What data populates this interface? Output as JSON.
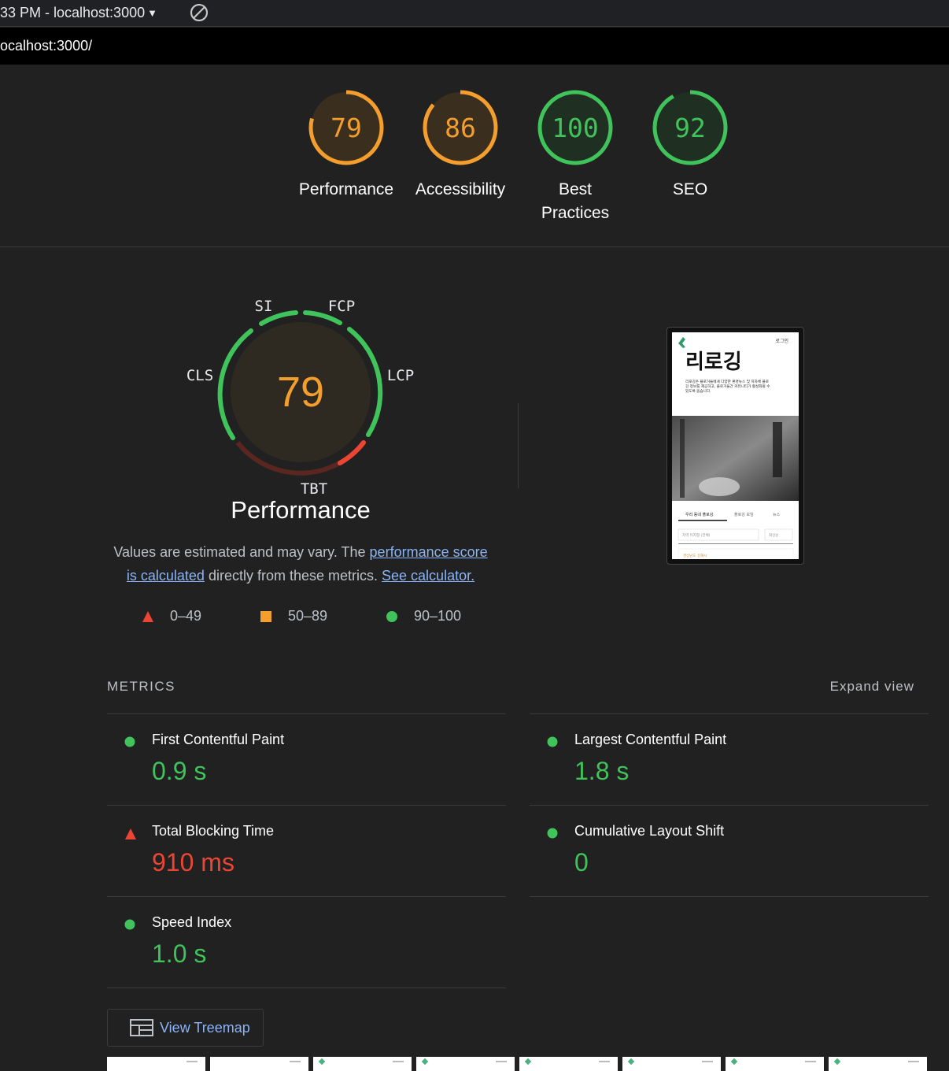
{
  "toolbar": {
    "report_select_label": "33 PM - localhost:3000",
    "clear_icon": "block-icon"
  },
  "url": "localhost:3000/",
  "categories": [
    {
      "name": "Performance",
      "score": 79,
      "color": "#f39e2d",
      "bg": "#3a2e1f"
    },
    {
      "name": "Accessibility",
      "score": 86,
      "color": "#f39e2d",
      "bg": "#3a2e1f"
    },
    {
      "name": "Best Practices",
      "score": 100,
      "color": "#3fc35a",
      "bg": "#1f2f22"
    },
    {
      "name": "SEO",
      "score": 92,
      "color": "#3fc35a",
      "bg": "#1f2f22"
    }
  ],
  "performance": {
    "score": 79,
    "title": "Performance",
    "metric_labels": {
      "si": "SI",
      "fcp": "FCP",
      "lcp": "LCP",
      "tbt": "TBT",
      "cls": "CLS"
    },
    "description_pre": "Values are estimated and may vary. The ",
    "link_score": "performance score is calculated",
    "description_mid": " directly from these metrics. ",
    "link_calculator": "See calculator."
  },
  "legend": [
    {
      "icon": "red-triangle-icon",
      "range": "0–49"
    },
    {
      "icon": "orange-square-icon",
      "range": "50–89"
    },
    {
      "icon": "green-circle-icon",
      "range": "90–100"
    }
  ],
  "metrics_section": {
    "title": "METRICS",
    "expand_label": "Expand view"
  },
  "metrics": [
    {
      "name": "First Contentful Paint",
      "value": "0.9 s",
      "status": "pass"
    },
    {
      "name": "Largest Contentful Paint",
      "value": "1.8 s",
      "status": "pass"
    },
    {
      "name": "Total Blocking Time",
      "value": "910 ms",
      "status": "fail"
    },
    {
      "name": "Cumulative Layout Shift",
      "value": "0",
      "status": "pass"
    },
    {
      "name": "Speed Index",
      "value": "1.0 s",
      "status": "pass"
    }
  ],
  "treemap_label": "View Treemap",
  "screenshot": {
    "login": "로그인",
    "brand": "리로깅",
    "desc_line1": "리로깅은 플로거들에게 다양한 환경뉴스 및 지자체 플로",
    "desc_line2": "깅 정보를 제공하고, 플로거들간 커뮤니티가 활성화될 수",
    "desc_line3": "있도록 돕습니다.",
    "tab1": "우리 동네 플로깅",
    "tab2": "플로깅 모임",
    "tab3": "뉴스",
    "filter1": "지역 미지정 (전체)",
    "filter2": "최신순",
    "item_tag": "경상남도 김해시"
  }
}
